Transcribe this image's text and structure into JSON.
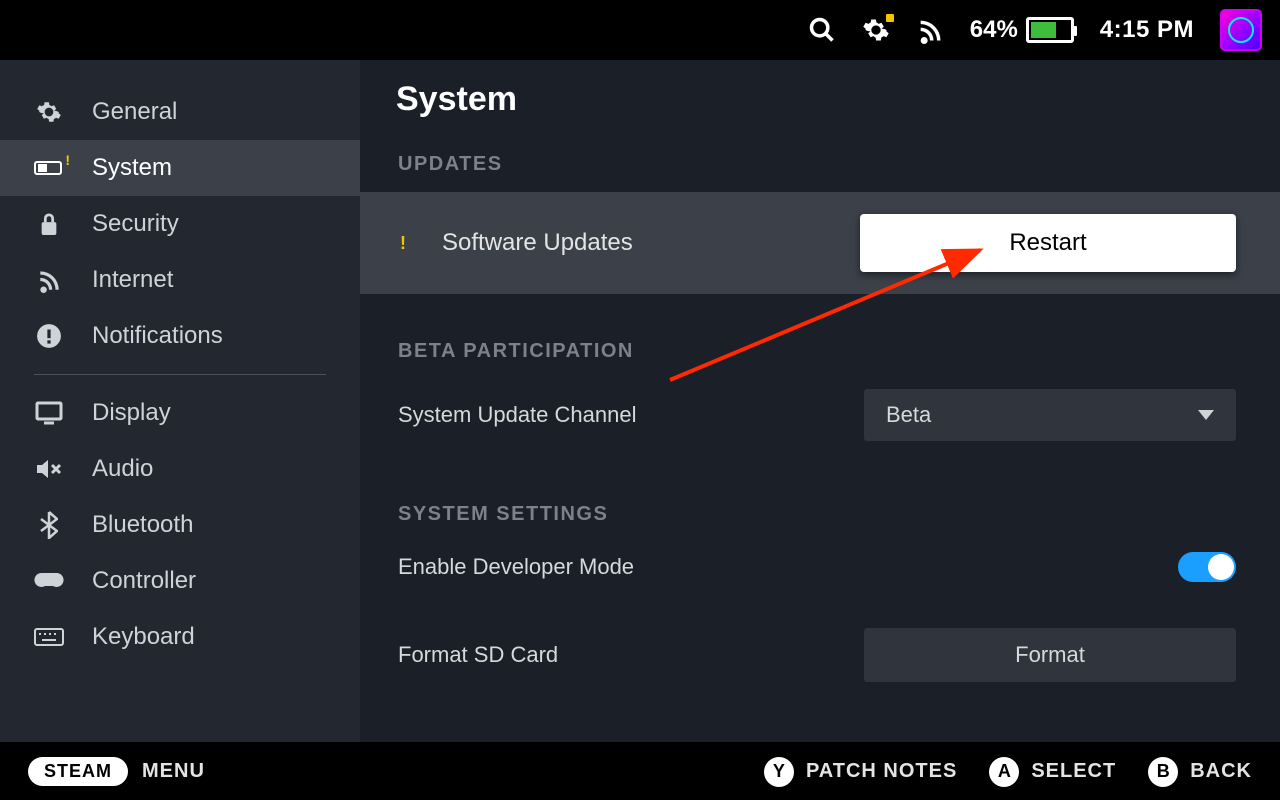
{
  "topbar": {
    "battery_percent": "64%",
    "clock": "4:15 PM"
  },
  "sidebar": {
    "items": [
      {
        "label": "General"
      },
      {
        "label": "System"
      },
      {
        "label": "Security"
      },
      {
        "label": "Internet"
      },
      {
        "label": "Notifications"
      },
      {
        "label": "Display"
      },
      {
        "label": "Audio"
      },
      {
        "label": "Bluetooth"
      },
      {
        "label": "Controller"
      },
      {
        "label": "Keyboard"
      }
    ]
  },
  "main": {
    "title": "System",
    "sections": {
      "updates": {
        "heading": "UPDATES",
        "row_label": "Software Updates",
        "button": "Restart"
      },
      "beta": {
        "heading": "BETA PARTICIPATION",
        "channel_label": "System Update Channel",
        "channel_value": "Beta"
      },
      "settings": {
        "heading": "SYSTEM SETTINGS",
        "dev_label": "Enable Developer Mode",
        "format_label": "Format SD Card",
        "format_button": "Format"
      }
    }
  },
  "bottombar": {
    "steam": "STEAM",
    "menu": "MENU",
    "y_label": "PATCH NOTES",
    "a_label": "SELECT",
    "b_label": "BACK"
  }
}
